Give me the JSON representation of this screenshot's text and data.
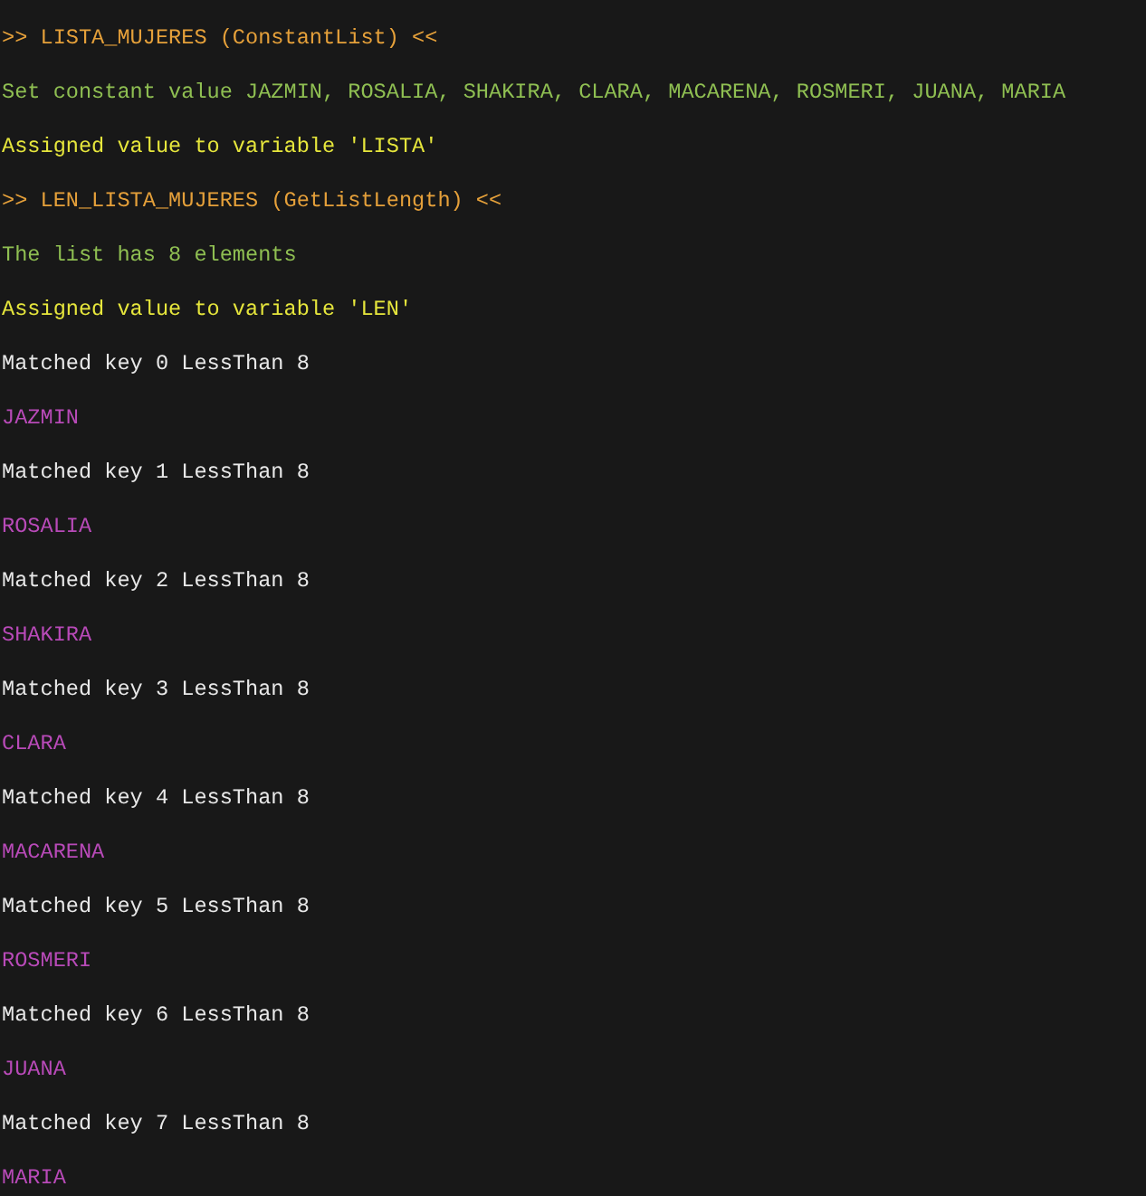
{
  "console": {
    "lines": [
      {
        "kind": "header",
        "text": ">> LISTA_MUJERES (ConstantList) <<"
      },
      {
        "kind": "result",
        "text": "Set constant value JAZMIN, ROSALIA, SHAKIRA, CLARA, MACARENA, ROSMERI, JUANA, MARIA"
      },
      {
        "kind": "assign",
        "text": "Assigned value to variable 'LISTA'"
      },
      {
        "kind": "header",
        "text": ">> LEN_LISTA_MUJERES (GetListLength) <<"
      },
      {
        "kind": "result",
        "text": "The list has 8 elements"
      },
      {
        "kind": "assign",
        "text": "Assigned value to variable 'LEN'"
      },
      {
        "kind": "plain",
        "text": "Matched key 0 LessThan 8"
      },
      {
        "kind": "print",
        "text": "JAZMIN"
      },
      {
        "kind": "plain",
        "text": "Matched key 1 LessThan 8"
      },
      {
        "kind": "print",
        "text": "ROSALIA"
      },
      {
        "kind": "plain",
        "text": "Matched key 2 LessThan 8"
      },
      {
        "kind": "print",
        "text": "SHAKIRA"
      },
      {
        "kind": "plain",
        "text": "Matched key 3 LessThan 8"
      },
      {
        "kind": "print",
        "text": "CLARA"
      },
      {
        "kind": "plain",
        "text": "Matched key 4 LessThan 8"
      },
      {
        "kind": "print",
        "text": "MACARENA"
      },
      {
        "kind": "plain",
        "text": "Matched key 5 LessThan 8"
      },
      {
        "kind": "print",
        "text": "ROSMERI"
      },
      {
        "kind": "plain",
        "text": "Matched key 6 LessThan 8"
      },
      {
        "kind": "print",
        "text": "JUANA"
      },
      {
        "kind": "plain",
        "text": "Matched key 7 LessThan 8"
      },
      {
        "kind": "print",
        "text": "MARIA"
      }
    ]
  }
}
